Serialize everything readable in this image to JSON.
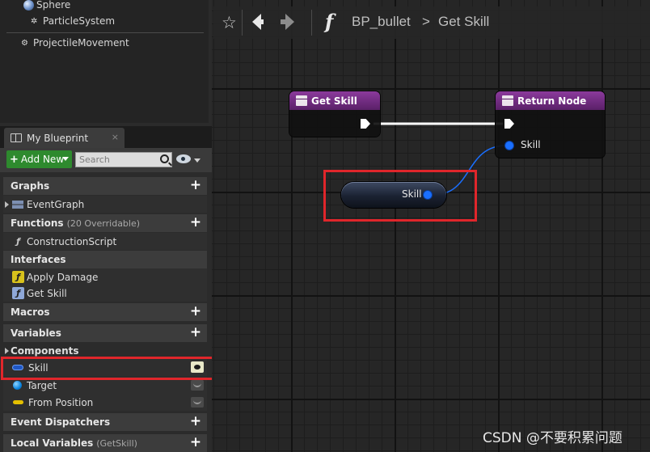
{
  "components": {
    "items": [
      "Sphere",
      "ParticleSystem",
      "ProjectileMovement"
    ]
  },
  "my_blueprint": {
    "tab_label": "My Blueprint",
    "close_label": "×",
    "add_new_label": "Add New",
    "search_placeholder": "Search",
    "sections": {
      "graphs": "Graphs",
      "functions": "Functions",
      "functions_sub": "(20 Overridable)",
      "interfaces": "Interfaces",
      "macros": "Macros",
      "variables": "Variables",
      "components": "Components",
      "event_dispatchers": "Event Dispatchers",
      "local_variables": "Local Variables",
      "local_variables_sub": "(GetSkill)"
    },
    "graph_items": [
      "EventGraph"
    ],
    "function_items": [
      "ConstructionScript"
    ],
    "interface_items": [
      "Apply Damage",
      "Get Skill"
    ],
    "variable_items": [
      "Skill",
      "Target",
      "From Position"
    ]
  },
  "graph": {
    "breadcrumb_root": "BP_bullet",
    "breadcrumb_sep": ">",
    "breadcrumb_current": "Get Skill",
    "nodes": {
      "entry_title": "Get Skill",
      "return_title": "Return Node",
      "return_pin": "Skill",
      "var_pin": "Skill"
    }
  },
  "watermark": "CSDN @不要积累问题",
  "colors": {
    "highlight": "#e0262b",
    "function_header": "#8b3a9c",
    "object_pin": "#1a6fff",
    "add_new": "#2e8a2e"
  }
}
